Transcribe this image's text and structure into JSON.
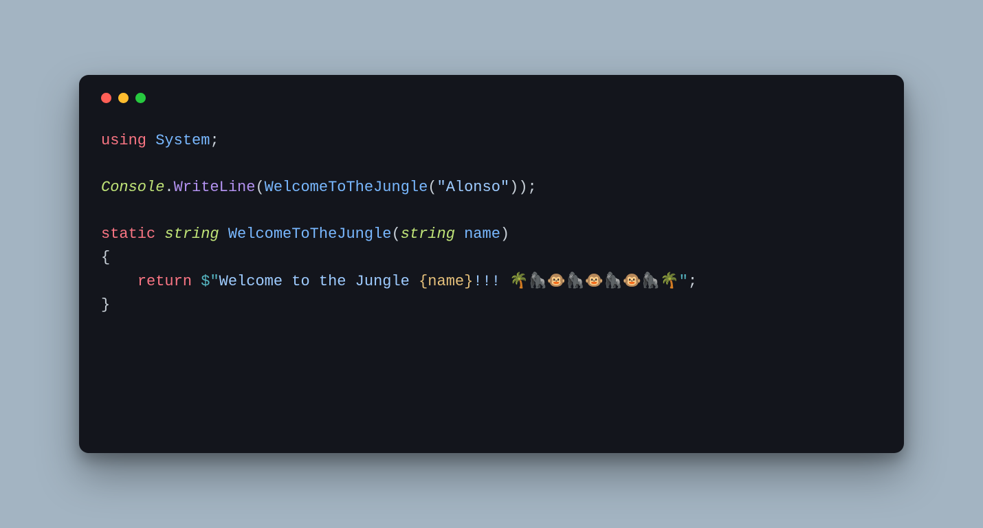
{
  "colors": {
    "bg": "#a3b4c2",
    "windowBg": "#13151c",
    "red": "#ff5f56",
    "yellow": "#ffbd2e",
    "green": "#27c93f"
  },
  "code": {
    "kw_using": "using",
    "ns_system": "System",
    "semi": ";",
    "cls_console": "Console",
    "dot": ".",
    "fn_writeln": "WriteLine",
    "lparen": "(",
    "rparen": ")",
    "fn_welcome": "WelcomeToTheJungle",
    "str_alonso_open": "\"",
    "str_alonso": "Alonso",
    "str_alonso_close": "\"",
    "kw_static": "static",
    "ty_string": "string",
    "param_name": "name",
    "lbrace": "{",
    "rbrace": "}",
    "indent": "    ",
    "kw_return": "return",
    "dollar": "$",
    "q_open": "\"",
    "msg_pre": "Welcome to the Jungle ",
    "interp_open": "{",
    "interp_name": "name",
    "interp_close": "}",
    "msg_post_bang": "!!! ",
    "emojis": "🌴🦍🐵🦍🐵🦍🐵🦍🌴",
    "q_close": "\""
  }
}
